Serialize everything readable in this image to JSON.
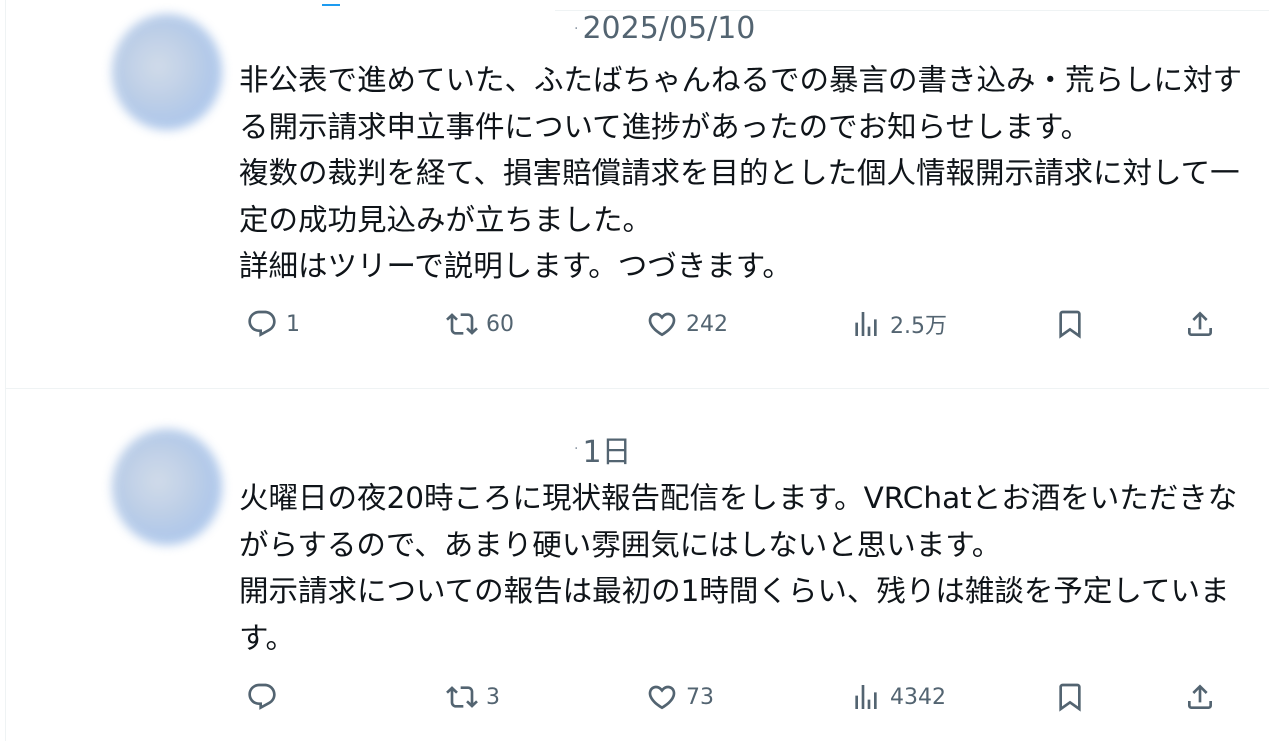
{
  "tweets": [
    {
      "timestamp": "2025/05/10",
      "lines": [
        "非公表で進めていた、ふたばちゃんねるでの暴言の書き込み・荒らしに対す",
        "る開示請求申立事件について進捗があったのでお知らせします。",
        "複数の裁判を経て、損害賠償請求を目的とした個人情報開示請求に対して一",
        "定の成功見込みが立ちました。",
        "詳細はツリーで説明します。つづきます。"
      ],
      "replies": "1",
      "reposts": "60",
      "likes": "242",
      "views": "2.5万"
    },
    {
      "timestamp": "1日",
      "lines": [
        "火曜日の夜20時ころに現状報告配信をします。VRChatとお酒をいただきな",
        "がらするので、あまり硬い雰囲気にはしないと思います。",
        "開示請求についての報告は最初の1時間くらい、残りは雑談を予定していま",
        "す。"
      ],
      "replies": "",
      "reposts": "3",
      "likes": "73",
      "views": "4342"
    }
  ],
  "icons": {
    "reply": "reply-icon",
    "repost": "repost-icon",
    "like": "heart-icon",
    "views": "views-icon",
    "bookmark": "bookmark-icon",
    "share": "share-icon"
  },
  "colors": {
    "text": "#0f1419",
    "secondary": "#536471",
    "divider": "#eff3f4",
    "accent": "#1d9bf0"
  }
}
